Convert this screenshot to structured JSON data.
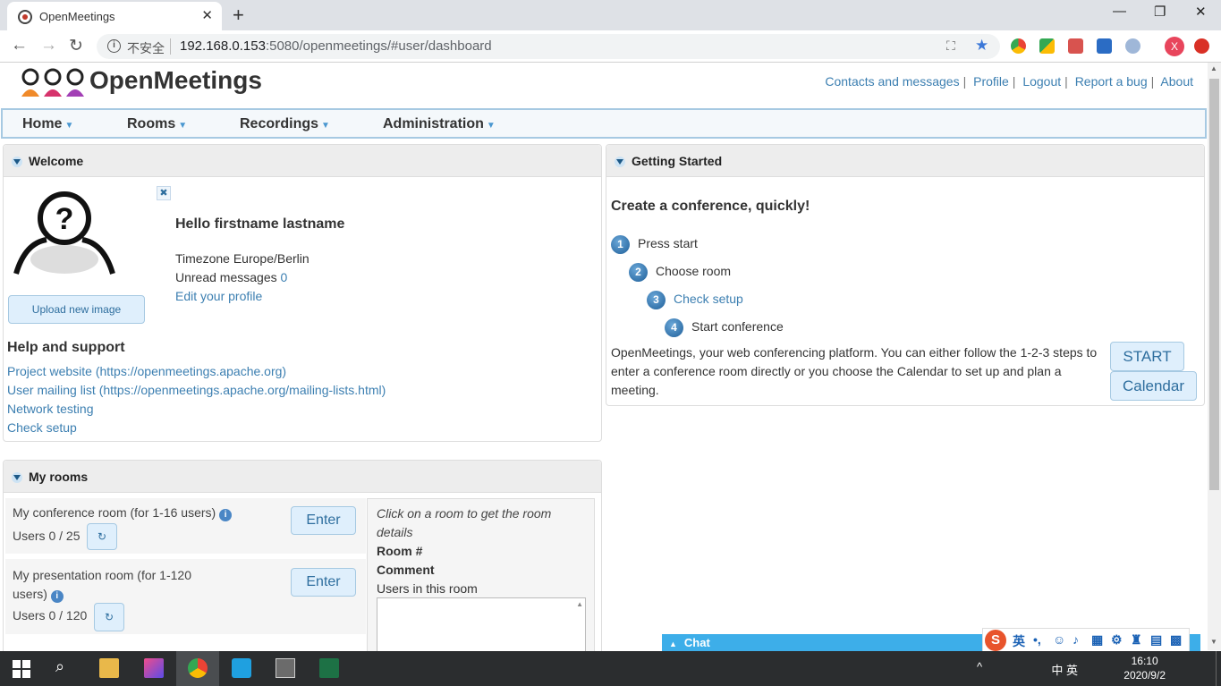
{
  "browser": {
    "tab_title": "OpenMeetings",
    "insecure_label": "不安全",
    "url_host": "192.168.0.153",
    "url_rest": ":5080/openmeetings/#user/dashboard"
  },
  "header": {
    "app_name": "OpenMeetings",
    "links": [
      "Contacts and messages",
      "Profile",
      "Logout",
      "Report a bug",
      "About"
    ]
  },
  "menu": [
    "Home",
    "Rooms",
    "Recordings",
    "Administration"
  ],
  "welcome": {
    "title": "Welcome",
    "upload_label": "Upload new image",
    "greeting": "Hello firstname lastname",
    "timezone": "Timezone Europe/Berlin",
    "unread_label": "Unread messages",
    "unread_count": "0",
    "edit_profile": "Edit your profile",
    "help_title": "Help and support",
    "help_links": [
      "Project website (https://openmeetings.apache.org)",
      "User mailing list (https://openmeetings.apache.org/mailing-lists.html)",
      "Network testing",
      "Check setup"
    ]
  },
  "getting_started": {
    "title": "Getting Started",
    "heading": "Create a conference, quickly!",
    "steps": [
      {
        "num": "1",
        "label": "Press start"
      },
      {
        "num": "2",
        "label": "Choose room"
      },
      {
        "num": "3",
        "label": "Check setup"
      },
      {
        "num": "4",
        "label": "Start conference"
      }
    ],
    "description": "OpenMeetings, your web conferencing platform. You can either follow the 1-2-3 steps to enter a conference room directly or you choose the Calendar to set up and plan a meeting.",
    "start_button": "START",
    "calendar_button": "Calendar"
  },
  "my_rooms": {
    "title": "My rooms",
    "rooms": [
      {
        "name": "My conference room (for 1-16 users)",
        "users": "Users 0 / 25",
        "enter": "Enter"
      },
      {
        "name_line1": "My presentation room (for 1-120",
        "name_line2": "users)",
        "users": "Users 0 / 120",
        "enter": "Enter"
      }
    ],
    "details_hint": "Click on a room to get the room details",
    "room_label": "Room",
    "room_value": "#",
    "comment_label": "Comment",
    "users_in_room": "Users in this room"
  },
  "chat": {
    "label": "Chat"
  },
  "ime": {
    "lang": "英"
  },
  "taskbar": {
    "time": "16:10",
    "date": "2020/9/2",
    "tray_text": "中  英"
  },
  "colors": {
    "link": "#3c7fb1",
    "menubar_border": "#a6c9e2",
    "chatbar": "#3daee9"
  }
}
